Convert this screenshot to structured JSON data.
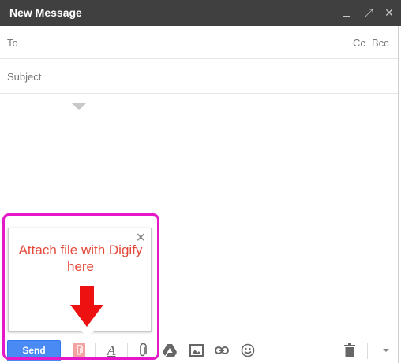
{
  "window": {
    "title": "New Message",
    "minimize_icon": "minimize-icon",
    "expand_icon": "expand-icon",
    "close_icon": "close-icon",
    "close_glyph": "✕",
    "expand_glyph": "⤢"
  },
  "fields": {
    "to_label": "To",
    "cc_label": "Cc",
    "bcc_label": "Bcc",
    "subject_label": "Subject"
  },
  "popup": {
    "message": "Attach file with Digify here",
    "close_glyph": "✕",
    "accent_color": "#e34a3a",
    "arrow_color": "#ee1111"
  },
  "highlight": {
    "color": "#e619c8"
  },
  "toolbar": {
    "send_label": "Send",
    "send_color": "#4a8af4",
    "format_glyph": "A",
    "icons": [
      "digify-icon",
      "format-text-icon",
      "attach-icon",
      "drive-icon",
      "photo-icon",
      "link-icon",
      "emoji-icon",
      "trash-icon",
      "more-options-icon"
    ]
  }
}
